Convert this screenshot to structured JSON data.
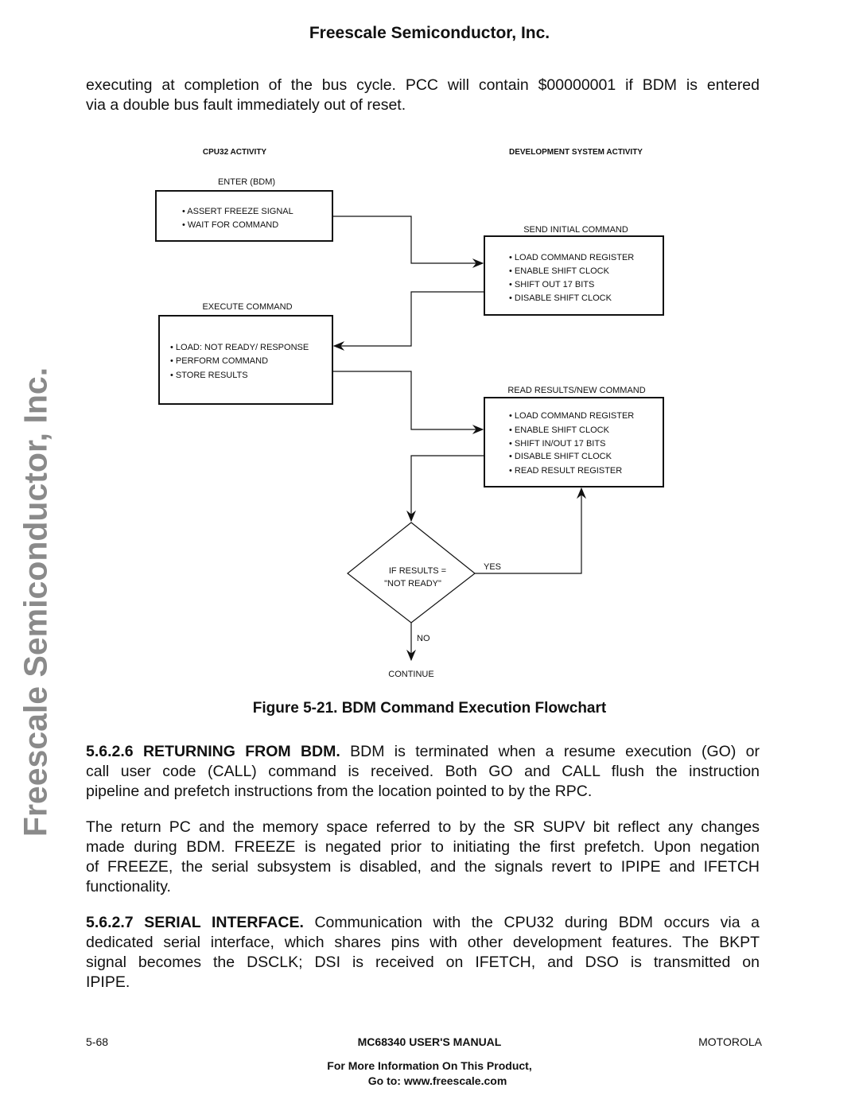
{
  "header": "Freescale Semiconductor, Inc.",
  "watermark": "Freescale Semiconductor, Inc.",
  "intro_lines": [
    "executing at completion of the bus cycle. PCC will contain $00000001 if BDM is entered",
    "via a double bus fault immediately out of reset."
  ],
  "flowchart": {
    "col_left": "CPU32  ACTIVITY",
    "col_right": "DEVELOPMENT SYSTEM  ACTIVITY",
    "enter_label": "ENTER (BDM)",
    "enter_items": [
      "• ASSERT FREEZE SIGNAL",
      "• WAIT FOR COMMAND"
    ],
    "send_label": "SEND INITIAL COMMAND",
    "send_items": [
      "• LOAD COMMAND REGISTER",
      "• ENABLE SHIFT CLOCK",
      "• SHIFT OUT 17 BITS",
      "• DISABLE SHIFT CLOCK"
    ],
    "exec_label": "EXECUTE COMMAND",
    "exec_items": [
      "• LOAD:  NOT READY/ RESPONSE",
      "• PERFORM COMMAND",
      "• STORE RESULTS"
    ],
    "read_label": "READ RESULTS/NEW COMMAND",
    "read_items": [
      "• LOAD COMMAND REGISTER",
      "• ENABLE SHIFT CLOCK",
      "• SHIFT IN/OUT 17 BITS",
      "• DISABLE SHIFT CLOCK",
      "• READ RESULT REGISTER"
    ],
    "decision": [
      "IF RESULTS =",
      "\"NOT READY\""
    ],
    "yes": "YES",
    "no": "NO",
    "continue": "CONTINUE"
  },
  "caption": "Figure 5-21. BDM Command Execution Flowchart",
  "p1": {
    "head": "5.6.2.6 RETURNING FROM BDM.",
    "lines": [
      " BDM is terminated when a resume execution (GO) or",
      "call user code (CALL) command is received. Both GO and CALL flush the instruction",
      "pipeline and prefetch instructions from the location pointed to by the RPC."
    ]
  },
  "p2": {
    "lines": [
      "The return PC and the memory space referred to by the SR SUPV bit reflect any changes",
      "made during BDM. FREEZE is negated prior to initiating the first prefetch. Upon negation",
      "of FREEZE, the serial subsystem is disabled, and the signals revert to IPIPE and IFETCH",
      "functionality."
    ]
  },
  "p3": {
    "head": "5.6.2.7 SERIAL INTERFACE.",
    "lines": [
      " Communication with the CPU32 during BDM occurs via a",
      "dedicated serial interface, which shares pins with other development features. The BKPT",
      "signal becomes the DSCLK; DSI is received on IFETCH, and DSO is transmitted on",
      "IPIPE."
    ]
  },
  "footer": {
    "page": "5-68",
    "title": "MC68340 USER'S MANUAL",
    "brand": "MOTOROLA",
    "more1": "For More Information On This Product,",
    "more2": "Go to: www.freescale.com"
  }
}
